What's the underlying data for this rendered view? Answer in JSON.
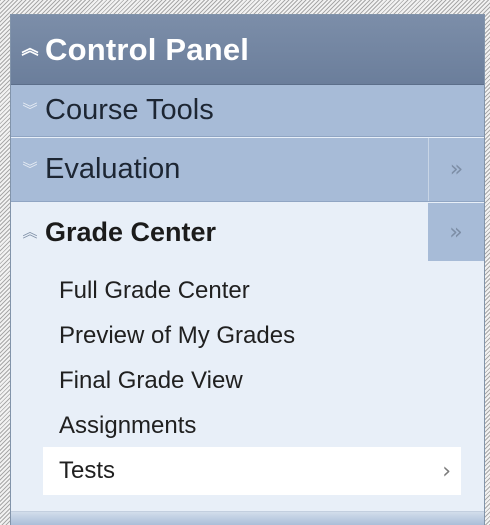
{
  "control_panel": {
    "title": "Control Panel",
    "expand_icon": "chevron-double-up-icon"
  },
  "sections": {
    "course_tools": {
      "label": "Course Tools",
      "icon": "chevron-double-down-icon"
    },
    "evaluation": {
      "label": "Evaluation",
      "icon": "chevron-double-down-icon",
      "side_icon": "double-right-arrow-icon"
    },
    "grade_center": {
      "label": "Grade Center",
      "icon": "chevron-double-up-icon",
      "side_icon": "double-right-arrow-icon"
    }
  },
  "grade_center_items": [
    {
      "label": "Full Grade Center"
    },
    {
      "label": "Preview of My Grades"
    },
    {
      "label": "Final Grade View"
    },
    {
      "label": "Assignments"
    },
    {
      "label": "Tests",
      "selected": true
    }
  ],
  "colors": {
    "header_bg": "#6b7e9b",
    "section_bg": "#a7bbd7",
    "panel_bg": "#e8eff8",
    "selected_bg": "#ffffff"
  }
}
